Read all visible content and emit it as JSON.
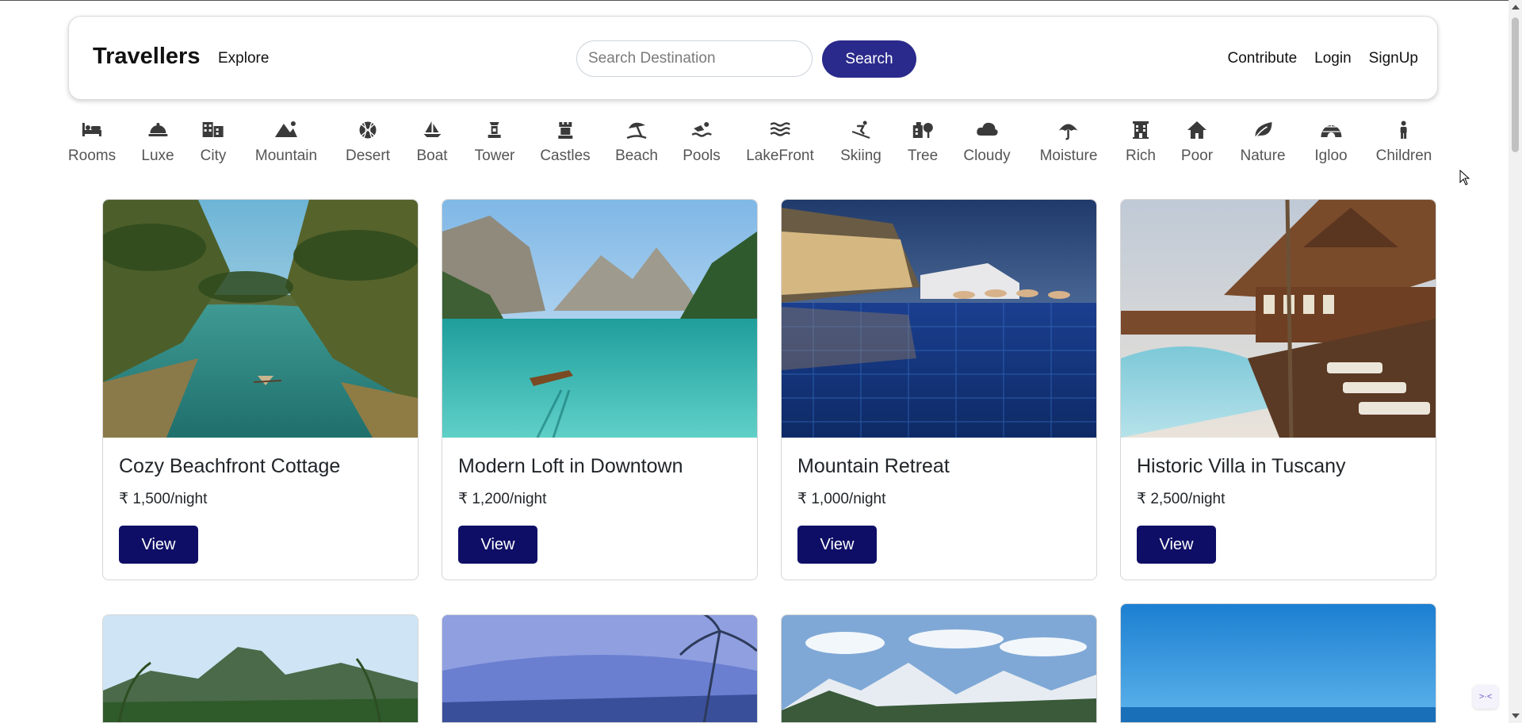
{
  "header": {
    "brand": "Travellers",
    "explore": "Explore",
    "search_placeholder": "Search Destination",
    "search_button": "Search",
    "links": [
      "Contribute",
      "Login",
      "SignUp"
    ]
  },
  "filters": [
    {
      "label": "Rooms",
      "icon": "bed-icon"
    },
    {
      "label": "Luxe",
      "icon": "cloche-icon"
    },
    {
      "label": "City",
      "icon": "buildings-icon"
    },
    {
      "label": "Mountain",
      "icon": "mountain-icon"
    },
    {
      "label": "Desert",
      "icon": "basketball-icon"
    },
    {
      "label": "Boat",
      "icon": "sailboat-icon"
    },
    {
      "label": "Tower",
      "icon": "tower-icon"
    },
    {
      "label": "Castles",
      "icon": "rook-icon"
    },
    {
      "label": "Beach",
      "icon": "umbrella-beach-icon"
    },
    {
      "label": "Pools",
      "icon": "swimmer-icon"
    },
    {
      "label": "LakeFront",
      "icon": "water-icon"
    },
    {
      "label": "Skiing",
      "icon": "skier-icon"
    },
    {
      "label": "Tree",
      "icon": "tree-city-icon"
    },
    {
      "label": "Cloudy",
      "icon": "cloud-icon"
    },
    {
      "label": "Moisture",
      "icon": "umbrella-icon"
    },
    {
      "label": "Rich",
      "icon": "hotel-icon"
    },
    {
      "label": "Poor",
      "icon": "house-icon"
    },
    {
      "label": "Nature",
      "icon": "leaf-icon"
    },
    {
      "label": "Igloo",
      "icon": "igloo-icon"
    },
    {
      "label": "Children",
      "icon": "child-icon"
    }
  ],
  "listings": [
    {
      "title": "Cozy Beachfront Cottage",
      "price": "₹ 1,500/night",
      "button": "View"
    },
    {
      "title": "Modern Loft in Downtown",
      "price": "₹ 1,200/night",
      "button": "View"
    },
    {
      "title": "Mountain Retreat",
      "price": "₹ 1,000/night",
      "button": "View"
    },
    {
      "title": "Historic Villa in Tuscany",
      "price": "₹ 2,500/night",
      "button": "View"
    }
  ]
}
